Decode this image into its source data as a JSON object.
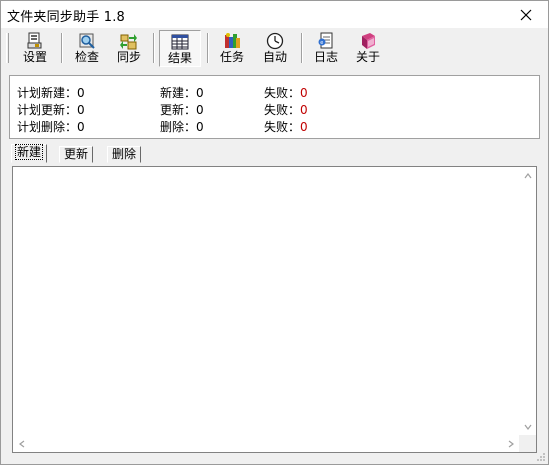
{
  "window": {
    "title": "文件夹同步助手 1.8"
  },
  "toolbar": {
    "buttons": [
      {
        "label": "设置",
        "icon": "settings-icon"
      },
      {
        "label": "检查",
        "icon": "check-icon"
      },
      {
        "label": "同步",
        "icon": "sync-icon"
      },
      {
        "label": "结果",
        "icon": "results-icon",
        "pressed": true
      },
      {
        "label": "任务",
        "icon": "tasks-icon"
      },
      {
        "label": "自动",
        "icon": "clock-icon"
      },
      {
        "label": "日志",
        "icon": "log-icon"
      },
      {
        "label": "关于",
        "icon": "book-icon"
      }
    ]
  },
  "summary": {
    "planned_new_label": "计划新建：",
    "planned_new_value": "0",
    "new_label": "新建：",
    "new_value": "0",
    "fail1_label": "失败：",
    "fail1_value": "0",
    "planned_update_label": "计划更新：",
    "planned_update_value": "0",
    "update_label": "更新：",
    "update_value": "0",
    "fail2_label": "失败：",
    "fail2_value": "0",
    "planned_delete_label": "计划删除：",
    "planned_delete_value": "0",
    "delete_label": "删除：",
    "delete_value": "0",
    "fail3_label": "失败：",
    "fail3_value": "0"
  },
  "tabs": [
    {
      "label": "新建",
      "active": true
    },
    {
      "label": "更新",
      "active": false
    },
    {
      "label": "删除",
      "active": false
    }
  ],
  "colors": {
    "fail_value": "#c00000",
    "window_bg": "#f0f0f0"
  }
}
